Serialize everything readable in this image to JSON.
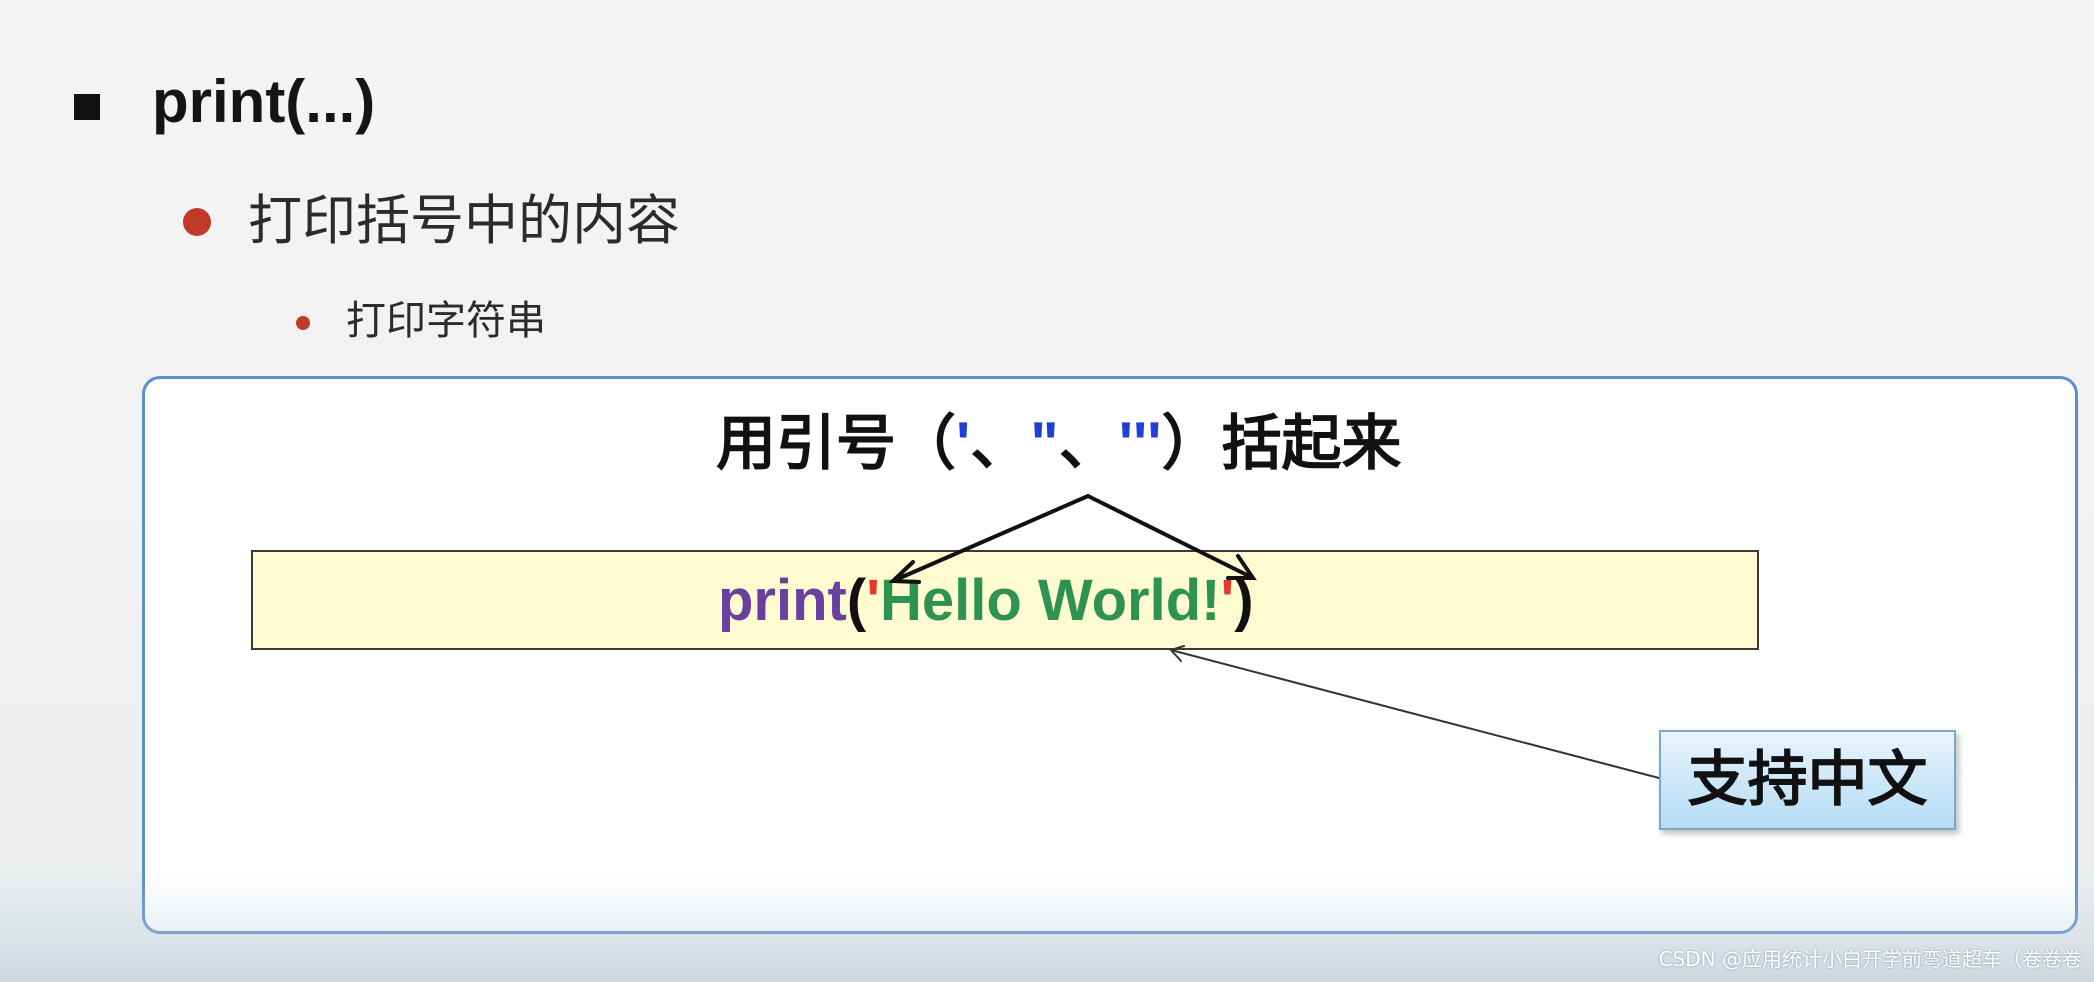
{
  "slide": {
    "heading": "print(...)",
    "subheading": "打印括号中的内容",
    "subsubheading": "打印字符串"
  },
  "panel": {
    "caption_prefix": "用引号（",
    "caption_q1": "'",
    "caption_sep1": "、",
    "caption_q2": "\"",
    "caption_sep2": "、",
    "caption_q3": "'''",
    "caption_suffix": "）括起来",
    "code": {
      "keyword": "print",
      "open_paren": "(",
      "open_quote": "'",
      "string": "Hello World!",
      "close_quote": "'",
      "close_paren": ")"
    },
    "callout": "支持中文"
  },
  "watermark": "CSDN @应用统计小白开学前弯道超车（卷卷卷",
  "colors": {
    "bullet_red": "#c0392b",
    "panel_border": "#5b8fd0",
    "code_bg": "#fffbd0",
    "keyword_purple": "#6a3fa0",
    "string_green": "#2e9350",
    "quote_red": "#e03a2a",
    "caption_quote_blue": "#1f3fd6"
  }
}
